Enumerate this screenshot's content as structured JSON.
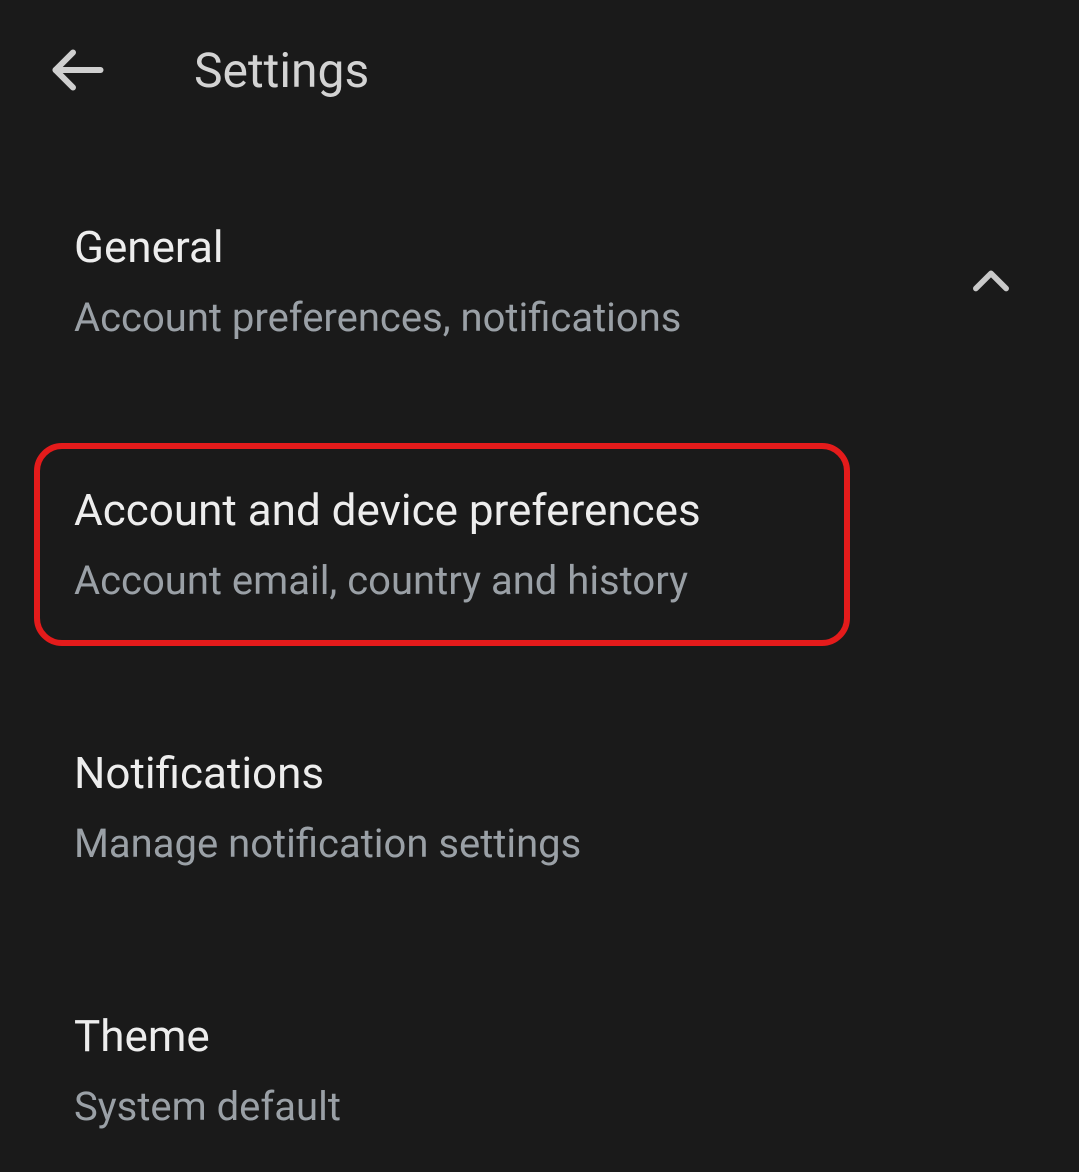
{
  "header": {
    "title": "Settings"
  },
  "items": [
    {
      "title": "General",
      "subtitle": "Account preferences, notifications",
      "expanded": true
    },
    {
      "title": "Account and device preferences",
      "subtitle": "Account email, country and history",
      "highlighted": true
    },
    {
      "title": "Notifications",
      "subtitle": "Manage notification settings"
    },
    {
      "title": "Theme",
      "subtitle": "System default"
    }
  ],
  "colors": {
    "highlight_border": "#e41b1b",
    "background": "#1a1a1a",
    "text_primary": "#ededed",
    "text_secondary": "#9aa0a6"
  }
}
